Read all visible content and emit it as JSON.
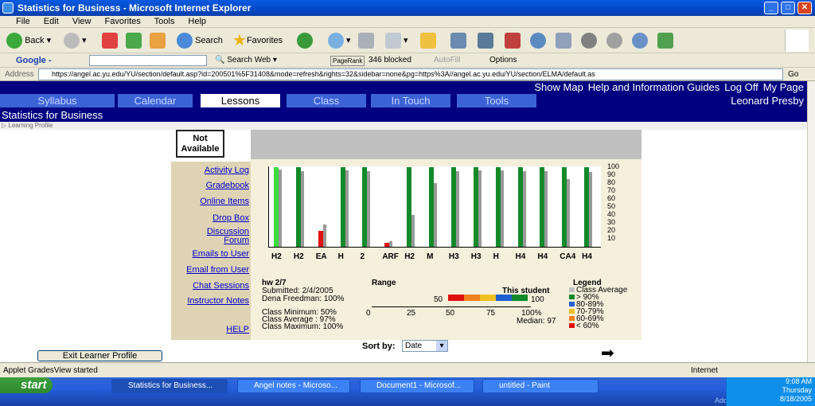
{
  "window": {
    "title": "Statistics for Business - Microsoft Internet Explorer"
  },
  "menu": [
    "File",
    "Edit",
    "View",
    "Favorites",
    "Tools",
    "Help"
  ],
  "toolbar": {
    "back": "Back",
    "search": "Search",
    "favorites": "Favorites"
  },
  "googlebar": {
    "label": "Google -",
    "search_web": "Search Web",
    "pagerank": "PageRank",
    "blocked": "346 blocked",
    "autofill": "AutoFill",
    "options": "Options"
  },
  "address": {
    "label": "Address",
    "url": "https://angel.ac.yu.edu/YU/section/default.asp?id=200501%5F31408&mode=refresh&rights=32&sidebar=none&pg=https%3A//angel.ac.yu.edu/YU/section/ELMA/default.as",
    "go": "Go"
  },
  "topstrip": {
    "show_map": "Show Map",
    "help": "Help and Information Guides",
    "logoff": "Log Off",
    "mypage": "My Page"
  },
  "nav": {
    "tabs": [
      "Syllabus",
      "Calendar",
      "Lessons",
      "Class",
      "In Touch",
      "Tools"
    ],
    "active": "Lessons",
    "user": "Leonard Presby"
  },
  "course": "Statistics for Business",
  "breadcrumb": "▷ Learning Profile",
  "side": {
    "not_available": "Not Available",
    "links": [
      "Activity Log",
      "Gradebook",
      "Online Items",
      "Drop Box",
      "Discussion Forum",
      "Emails to User",
      "Email from User",
      "Chat Sessions",
      "Instructor Notes"
    ],
    "help": "HELP"
  },
  "chart_data": {
    "type": "bar",
    "categories": [
      "H2",
      "H2",
      "EA",
      "H",
      "2",
      "ARF",
      "H2",
      "M",
      "H3",
      "H3",
      "H",
      "H4",
      "H4",
      "CA4",
      "H4"
    ],
    "series": [
      {
        "name": "This student",
        "values": [
          100,
          100,
          20,
          100,
          100,
          5,
          100,
          100,
          100,
          100,
          100,
          100,
          100,
          100,
          100
        ]
      },
      {
        "name": "Class Average",
        "values": [
          97,
          95,
          28,
          96,
          95,
          7,
          40,
          80,
          95,
          96,
          96,
          95,
          95,
          85,
          94
        ]
      }
    ],
    "ylim": [
      0,
      100
    ],
    "yticks": [
      "100",
      "90",
      "80",
      "70",
      "60",
      "50",
      "40",
      "30",
      "20",
      "10"
    ]
  },
  "assignment": {
    "name": "hw 2/7",
    "submitted": "Submitted: 2/4/2005",
    "student_score": "Dena Freedman: 100%",
    "class_min": "Class Minimum: 50%",
    "class_avg": "Class Average  : 97%",
    "class_max": "Class Maximum: 100%"
  },
  "range": {
    "label": "Range",
    "this_student": "This student",
    "low": "50",
    "high": "100",
    "ticks": [
      "0",
      "25",
      "50",
      "75",
      "100%"
    ],
    "median": "Median: 97"
  },
  "legend": {
    "title": "Legend",
    "items": [
      "Class Average",
      "> 90%",
      "80-89%",
      "70-79%",
      "60-69%",
      "< 60%"
    ],
    "colors": [
      "#c0c0c0",
      "#128a2a",
      "#1f5fd0",
      "#f0c020",
      "#f08020",
      "#e01010"
    ]
  },
  "sort": {
    "label": "Sort by:",
    "value": "Date"
  },
  "exit_button": "Exit Learner Profile",
  "status": {
    "text": "Applet GradesView started",
    "zone": "Internet"
  },
  "taskbar": {
    "start": "start",
    "tasks": [
      "Statistics for Business...",
      "Angel notes - Microso...",
      "Document1 - Microsof...",
      "untitled - Paint"
    ],
    "time": "9:08 AM",
    "day": "Thursday",
    "date": "8/18/2005",
    "address": "Address"
  }
}
